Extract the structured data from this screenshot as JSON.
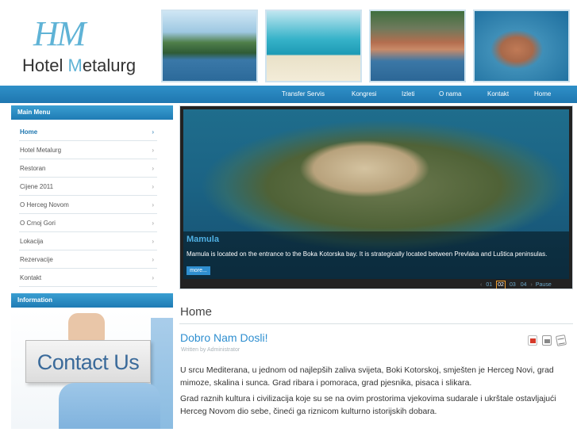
{
  "header": {
    "logo_monogram": "HM",
    "logo_name_part1": "Hotel ",
    "logo_name_m": "M",
    "logo_name_part2": "etalurg"
  },
  "nav": {
    "items": [
      "Transfer Servis",
      "Kongresi",
      "Izleti",
      "O nama",
      "Kontakt",
      "Home"
    ]
  },
  "sidebar": {
    "menu_title": "Main Menu",
    "menu_items": [
      {
        "label": "Home",
        "active": true
      },
      {
        "label": "Hotel Metalurg"
      },
      {
        "label": "Restoran"
      },
      {
        "label": "Cijene 2011"
      },
      {
        "label": "O Herceg Novom"
      },
      {
        "label": "O Crnoj Gori"
      },
      {
        "label": "Lokacija"
      },
      {
        "label": "Rezervacije"
      },
      {
        "label": "Kontakt"
      }
    ],
    "arrow_glyph": "›",
    "info_title": "Information",
    "contact_image_text": "Contact Us"
  },
  "slideshow": {
    "title": "Mamula",
    "description": "Mamula is located on the entrance to the Boka Kotorska bay. It is strategically located between Prevlaka and Luštica peninsulas.",
    "more_label": "more...",
    "prev_glyph": "‹",
    "numbers": [
      "01",
      "02",
      "03",
      "04"
    ],
    "current": "02",
    "next_glyph": "›",
    "pause_label": "Pause"
  },
  "content": {
    "page_title": "Home",
    "article_title": "Dobro Nam Dosli!",
    "article_author": "Written by Administrator",
    "paragraph_1": "U srcu Mediterana, u jednom od najlepših zaliva svijeta, Boki Kotorskoj, smješten je Herceg Novi, grad mimoze, skalina i sunca. Grad ribara i pomoraca, grad pjesnika, pisaca i slikara.",
    "paragraph_2": "Grad raznih kultura i civilizacija koje su se na ovim prostorima vjekovima sudarale i ukrštale ostavljajući Herceg Novom dio sebe, čineći ga riznicom kulturno istorijskih dobara."
  },
  "colors": {
    "accent": "#2f8fd0",
    "nav_bar": "#1f77b0",
    "logo": "#5fb3d6"
  },
  "icons": {
    "pdf": "pdf-icon",
    "print": "print-icon",
    "email": "email-icon"
  }
}
